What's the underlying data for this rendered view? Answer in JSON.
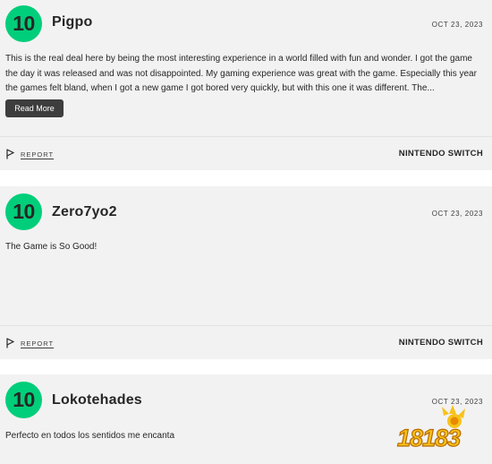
{
  "reviews": [
    {
      "score": "10",
      "username": "Pigpo",
      "date": "OCT 23, 2023",
      "text": "This is the real deal here by being the most interesting experience in a world filled with fun and wonder. I got the game the day it was released and was not disappointed. My gaming experience was great with the game. Especially this year the games felt bland, when I got a new game I got bored very quickly, but with this one it was different. The...",
      "read_more_label": "Read More",
      "report_label": "REPORT",
      "platform": "NINTENDO SWITCH"
    },
    {
      "score": "10",
      "username": "Zero7yo2",
      "date": "OCT 23, 2023",
      "text": "The Game is So Good!",
      "report_label": "REPORT",
      "platform": "NINTENDO SWITCH"
    },
    {
      "score": "10",
      "username": "Lokotehades",
      "date": "OCT 23, 2023",
      "text": "Perfecto en todos los sentidos me encanta"
    }
  ],
  "watermark": {
    "text": "18183"
  },
  "colors": {
    "score_green": "#00ce7a",
    "card_bg": "#f2f2f2",
    "button_dark": "#3d3d3d"
  }
}
